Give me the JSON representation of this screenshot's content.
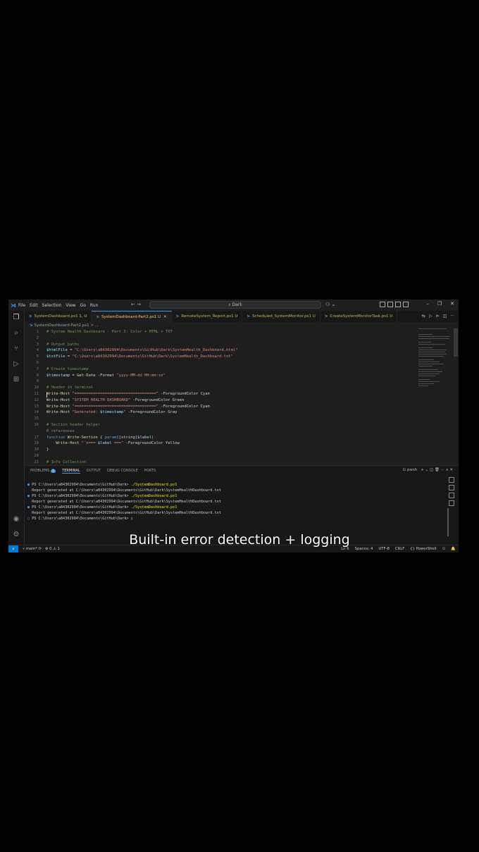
{
  "titlebar": {
    "menu": [
      "File",
      "Edit",
      "Selection",
      "View",
      "Go",
      "Run"
    ],
    "nav": "← →",
    "search": "Dark",
    "copilot": "⚇ ⌄",
    "controls": [
      "–",
      "❐",
      "✕"
    ]
  },
  "tabs": [
    {
      "label": "SystemDashboard.ps1",
      "status": "1, U",
      "active": false
    },
    {
      "label": "SystemDashboard-Part2.ps1",
      "status": "U",
      "active": true
    },
    {
      "label": "RemoteSystem_Report.ps1",
      "status": "U",
      "active": false
    },
    {
      "label": "Scheduled_SystemMonitor.ps1",
      "status": "U",
      "active": false
    },
    {
      "label": "CreateSystemMonitorTask.ps1",
      "status": "U",
      "active": false
    }
  ],
  "breadcrumb": "SystemDashboard-Part2.ps1 > ...",
  "editor": {
    "lines": [
      {
        "n": "1",
        "parts": [
          {
            "c": "c-com",
            "t": "# System Health Dashboard - Part 3: Color + HTML + TXT"
          }
        ]
      },
      {
        "n": "2",
        "parts": []
      },
      {
        "n": "3",
        "parts": [
          {
            "c": "c-com",
            "t": "# Output paths"
          }
        ]
      },
      {
        "n": "4",
        "parts": [
          {
            "c": "c-var",
            "t": "$htmlFile"
          },
          {
            "c": "c-op",
            "t": " = "
          },
          {
            "c": "c-str",
            "t": "\"C:\\Users\\a84302994\\Documents\\GitHub\\Dark\\SystemHealth_Dashboard.html\""
          }
        ]
      },
      {
        "n": "5",
        "parts": [
          {
            "c": "c-var",
            "t": "$txtFile"
          },
          {
            "c": "c-op",
            "t": " = "
          },
          {
            "c": "c-str",
            "t": "\"C:\\Users\\a84302994\\Documents\\GitHub\\Dark\\SystemHealth_Dashboard.txt\""
          }
        ]
      },
      {
        "n": "6",
        "parts": []
      },
      {
        "n": "7",
        "parts": [
          {
            "c": "c-com",
            "t": "# Create timestamp"
          }
        ]
      },
      {
        "n": "8",
        "parts": [
          {
            "c": "c-var",
            "t": "$timestamp"
          },
          {
            "c": "c-op",
            "t": " = "
          },
          {
            "c": "c-cmd",
            "t": "Get-Date"
          },
          {
            "c": "c-plain",
            "t": " -Format "
          },
          {
            "c": "c-str",
            "t": "\"yyyy-MM-dd HH:mm:ss\""
          }
        ]
      },
      {
        "n": "9",
        "parts": []
      },
      {
        "n": "10",
        "parts": [
          {
            "c": "c-com",
            "t": "# Header in terminal"
          }
        ]
      },
      {
        "n": "11",
        "parts": [
          {
            "c": "c-cmd",
            "t": "Write-Host"
          },
          {
            "c": "c-str",
            "t": " \"===================================\""
          },
          {
            "c": "c-plain",
            "t": " -ForegroundColor Cyan"
          }
        ]
      },
      {
        "n": "12",
        "parts": [
          {
            "c": "c-cmd",
            "t": "Write-Host"
          },
          {
            "c": "c-str",
            "t": " \"SYSTEM HEALTH DASHBOARD\""
          },
          {
            "c": "c-plain",
            "t": " -ForegroundColor Green"
          }
        ]
      },
      {
        "n": "13",
        "parts": [
          {
            "c": "c-cmd",
            "t": "Write-Host"
          },
          {
            "c": "c-str",
            "t": " \"===================================\""
          },
          {
            "c": "c-plain",
            "t": " -ForegroundColor Cyan"
          }
        ]
      },
      {
        "n": "14",
        "parts": [
          {
            "c": "c-cmd",
            "t": "Write-Host"
          },
          {
            "c": "c-str",
            "t": " \"Generated: "
          },
          {
            "c": "c-var",
            "t": "$timestamp"
          },
          {
            "c": "c-str",
            "t": "\""
          },
          {
            "c": "c-plain",
            "t": " -ForegroundColor Gray"
          }
        ]
      },
      {
        "n": "15",
        "parts": []
      },
      {
        "n": "16",
        "parts": [
          {
            "c": "c-com",
            "t": "# Section header helper"
          }
        ]
      },
      {
        "n": "",
        "parts": [
          {
            "c": "c-ref",
            "t": "0 references"
          }
        ]
      },
      {
        "n": "17",
        "parts": [
          {
            "c": "c-kw",
            "t": "function"
          },
          {
            "c": "c-cmd",
            "t": " Write-Section"
          },
          {
            "c": "c-plain",
            "t": " { "
          },
          {
            "c": "c-kw",
            "t": "param"
          },
          {
            "c": "c-plain",
            "t": "([string]"
          },
          {
            "c": "c-param",
            "t": "$label"
          },
          {
            "c": "c-plain",
            "t": ")"
          }
        ]
      },
      {
        "n": "18",
        "parts": [
          {
            "c": "c-plain",
            "t": "    "
          },
          {
            "c": "c-cmd",
            "t": "Write-Host"
          },
          {
            "c": "c-str",
            "t": " \"`n=== "
          },
          {
            "c": "c-var",
            "t": "$label"
          },
          {
            "c": "c-str",
            "t": " ===\""
          },
          {
            "c": "c-plain",
            "t": " -ForegroundColor Yellow"
          }
        ]
      },
      {
        "n": "19",
        "parts": [
          {
            "c": "c-plain",
            "t": "}"
          }
        ]
      },
      {
        "n": "20",
        "parts": []
      },
      {
        "n": "21",
        "parts": [
          {
            "c": "c-com",
            "t": "# Info Collection"
          }
        ]
      }
    ]
  },
  "panel": {
    "tabs": [
      "PROBLEMS",
      "TERMINAL",
      "OUTPUT",
      "DEBUG CONSOLE",
      "PORTS"
    ],
    "problems_count": "1",
    "active_tab": "TERMINAL",
    "shell": "pwsh",
    "actions": "+ ⌄ ◫ 🗑 ··· ∧ ✕",
    "terminal_lines": [
      {
        "prefix": "● ",
        "prompt": "PS C:\\Users\\a84302994\\Documents\\GitHub\\Dark> ",
        "cmd": "./SystemDashboard.ps1"
      },
      {
        "prefix": "  ",
        "prompt": "Report generated at C:\\Users\\a84302994\\Documents\\GitHub\\Dark\\SystemHealthDashboard.txt",
        "cmd": ""
      },
      {
        "prefix": "● ",
        "prompt": "PS C:\\Users\\a84302994\\Documents\\GitHub\\Dark> ",
        "cmd": "./SystemDashboard.ps1"
      },
      {
        "prefix": "  ",
        "prompt": "Report generated at C:\\Users\\a84302994\\Documents\\GitHub\\Dark\\SystemHealthDashboard.txt",
        "cmd": ""
      },
      {
        "prefix": "● ",
        "prompt": "PS C:\\Users\\a84302994\\Documents\\GitHub\\Dark> ",
        "cmd": "./SystemDashboard.ps1"
      },
      {
        "prefix": "  ",
        "prompt": "Report generated at C:\\Users\\a84302994\\Documents\\GitHub\\Dark\\SystemHealthDashboard.txt",
        "cmd": ""
      },
      {
        "prefix": "○ ",
        "prompt": "PS C:\\Users\\a84302994\\Documents\\GitHub\\Dark> ▯",
        "cmd": ""
      }
    ]
  },
  "status": {
    "branch": "main*",
    "sync": "⟳",
    "problems": "⊗ 0 ⚠ 1",
    "right": [
      "Ln 6",
      "Spaces: 4",
      "UTF-8",
      "CRLF",
      "{} PowerShell",
      "⚇",
      "🔔"
    ]
  },
  "caption": "Built-in error detection + logging",
  "colors": {
    "accent": "#0078d4",
    "background": "#1e1e1e",
    "string": "#ce9178",
    "comment": "#6a9955"
  }
}
